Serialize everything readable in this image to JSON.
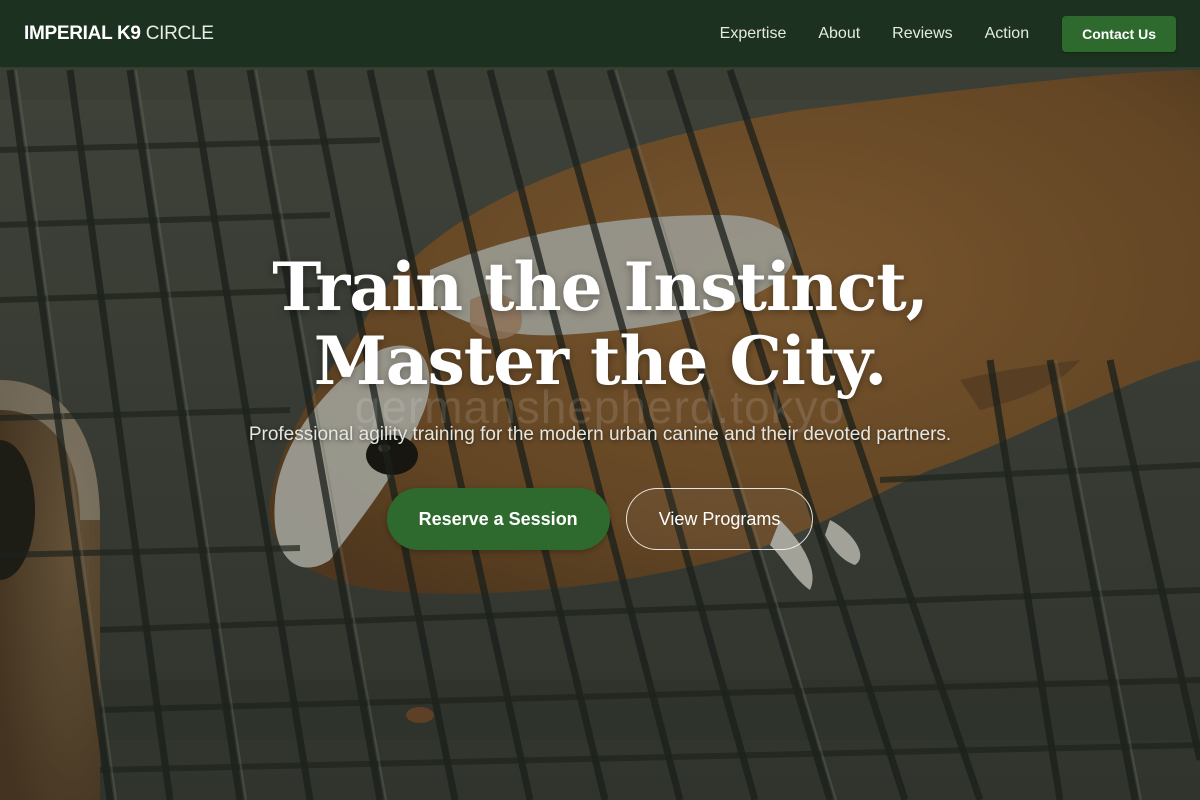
{
  "brand": {
    "name_strong": "IMPERIAL K9",
    "name_light": "CIRCLE"
  },
  "nav": {
    "links": [
      "Expertise",
      "About",
      "Reviews",
      "Action"
    ],
    "cta_label": "Contact Us"
  },
  "hero": {
    "title_line1": "Train the Instinct,",
    "title_line2": "Master the City.",
    "watermark_text": "germanshepherd.tokyo",
    "subtitle": "Professional agility training for the modern urban canine and their devoted partners.",
    "primary_cta": "Reserve a Session",
    "secondary_cta": "View Programs"
  },
  "colors": {
    "nav_background": "#1b301e",
    "accent_green": "#2e6a2e",
    "text_white": "#ffffff"
  }
}
